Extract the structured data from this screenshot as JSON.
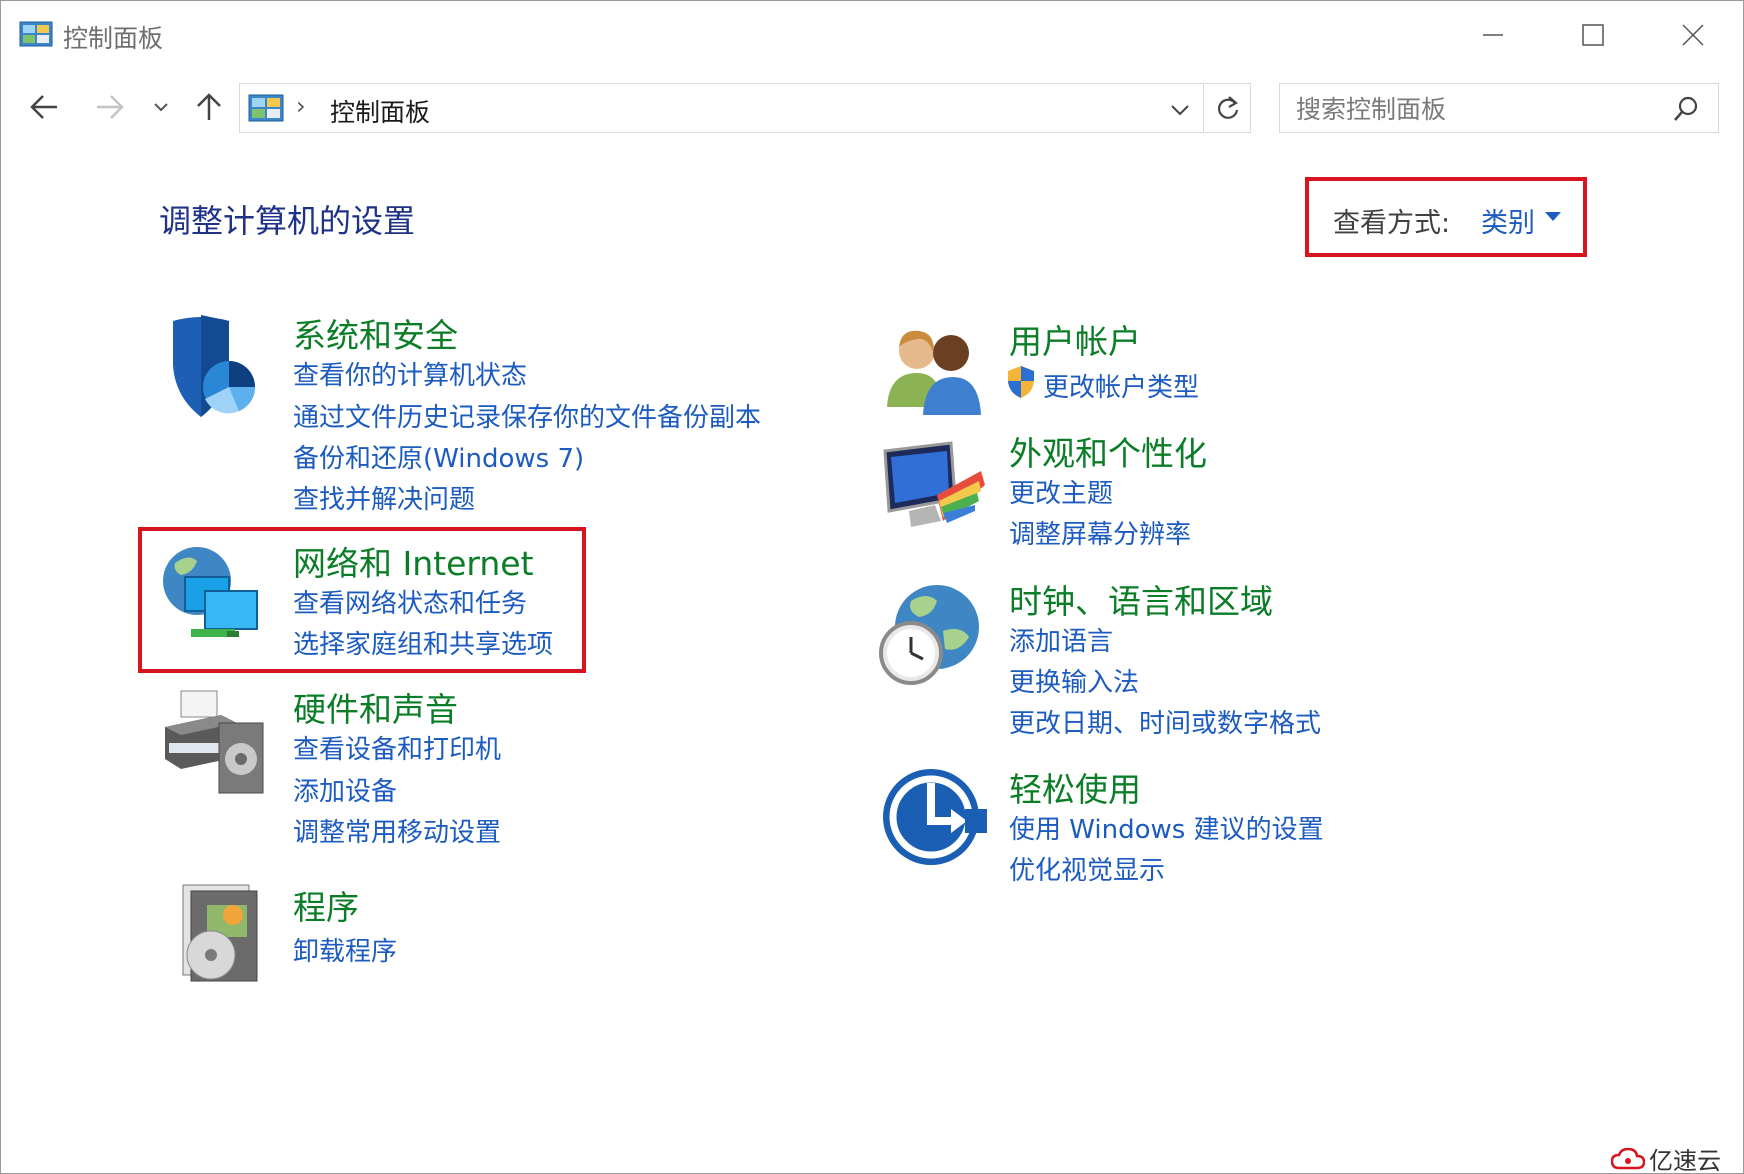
{
  "window": {
    "title": "控制面板"
  },
  "nav": {
    "breadcrumb_sep": "›",
    "address": "控制面板"
  },
  "search": {
    "placeholder": "搜索控制面板"
  },
  "main": {
    "heading": "调整计算机的设置",
    "view_by_label": "查看方式:",
    "view_by_value": "类别"
  },
  "categories": {
    "system": {
      "title": "系统和安全",
      "links": [
        "查看你的计算机状态",
        "通过文件历史记录保存你的文件备份副本",
        "备份和还原(Windows 7)",
        "查找并解决问题"
      ],
      "icon": "shield-icon"
    },
    "network": {
      "title": "网络和 Internet",
      "links": [
        "查看网络状态和任务",
        "选择家庭组和共享选项"
      ],
      "icon": "network-globe-icon"
    },
    "hardware": {
      "title": "硬件和声音",
      "links": [
        "查看设备和打印机",
        "添加设备",
        "调整常用移动设置"
      ],
      "icon": "printer-speaker-icon"
    },
    "programs": {
      "title": "程序",
      "links": [
        "卸载程序"
      ],
      "icon": "programs-disc-icon"
    },
    "users": {
      "title": "用户帐户",
      "links": [
        "更改帐户类型"
      ],
      "icon": "users-icon"
    },
    "appearance": {
      "title": "外观和个性化",
      "links": [
        "更改主题",
        "调整屏幕分辨率"
      ],
      "icon": "monitor-palette-icon"
    },
    "clock": {
      "title": "时钟、语言和区域",
      "links": [
        "添加语言",
        "更换输入法",
        "更改日期、时间或数字格式"
      ],
      "icon": "globe-clock-icon"
    },
    "ease": {
      "title": "轻松使用",
      "links": [
        "使用 Windows 建议的设置",
        "优化视觉显示"
      ],
      "icon": "ease-of-access-icon"
    }
  },
  "watermark": {
    "text": "亿速云"
  },
  "colors": {
    "category_title": "#0b7d27",
    "link": "#1c5bbf",
    "heading": "#1e3287",
    "highlight_box": "#d7141f"
  }
}
